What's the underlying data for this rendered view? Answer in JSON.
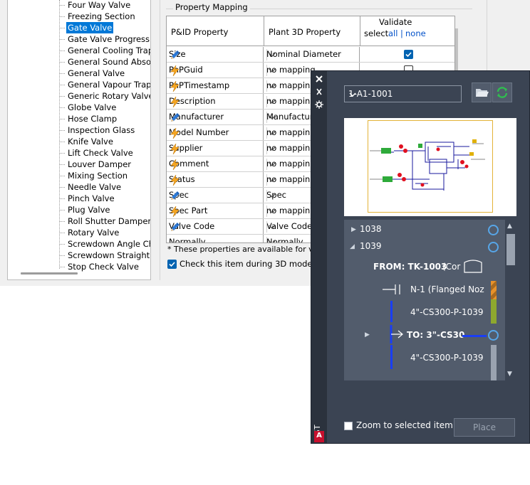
{
  "tree": {
    "items": [
      "Four Way Valve",
      "Freezing Section",
      "Gate Valve",
      "Gate Valve Progressi",
      "General Cooling Trap",
      "General Sound Abso",
      "General Valve",
      "General Vapour Trap",
      "Generic Rotary Valve",
      "Globe Valve",
      "Hose Clamp",
      "Inspection Glass",
      "Knife Valve",
      "Lift Check Valve",
      "Louver Damper",
      "Mixing Section",
      "Needle Valve",
      "Pinch Valve",
      "Plug Valve",
      "Roll Shutter Damper",
      "Rotary Valve",
      "Screwdown Angle Ch",
      "Screwdown Straight",
      "Stop Check Valve"
    ],
    "selected_index": 2
  },
  "mapping": {
    "group_title": "Property Mapping",
    "col_pid": "P&ID Property",
    "col_plant": "Plant 3D Property",
    "col_validate": "Validate",
    "select_label": "select",
    "select_all": "all",
    "select_sep": "|",
    "select_none": "none",
    "rows": [
      {
        "name": "Size",
        "icon": "pencil-icon",
        "map": "Nominal Diameter",
        "checked": true
      },
      {
        "name": "PnPGuid",
        "icon": "lightning-icon",
        "map": "no mapping",
        "checked": false
      },
      {
        "name": "PnPTimestamp",
        "icon": "lightning-icon",
        "map": "no mapping",
        "checked": false
      },
      {
        "name": "Description",
        "icon": "lightning-icon",
        "map": "no mapping",
        "checked": false
      },
      {
        "name": "Manufacturer",
        "icon": "pencil-icon",
        "map": "Manufacturer",
        "checked": false
      },
      {
        "name": "Model Number",
        "icon": "lightning-icon",
        "map": "no mapping",
        "checked": false
      },
      {
        "name": "Supplier",
        "icon": "lightning-icon",
        "map": "no mapping",
        "checked": false
      },
      {
        "name": "Comment",
        "icon": "lightning-icon",
        "map": "no mapping",
        "checked": false
      },
      {
        "name": "Status",
        "icon": "lightning-icon",
        "map": "no mapping",
        "checked": false
      },
      {
        "name": "Spec",
        "icon": "pencil-icon",
        "map": "Spec",
        "checked": false
      },
      {
        "name": "Spec Part",
        "icon": "lightning-icon",
        "map": "no mapping",
        "checked": false
      },
      {
        "name": "Valve Code",
        "icon": "pencil-icon",
        "map": "Valve Code",
        "checked": false
      },
      {
        "name": "Normally",
        "icon": "",
        "map": "Normally",
        "checked": false
      }
    ],
    "footnote": "* These properties are available for valida",
    "check_label": "Check this item during 3D model to Pa"
  },
  "palette": {
    "title": "P&ID LINE LIST",
    "drawing": "1-A1-1001",
    "tree": {
      "n1038": "1038",
      "n1039": "1039",
      "from_bold": "FROM: TK-1003",
      "from_rest": "(Cor",
      "nozzle": "N-1  (Flanged Noz",
      "line1": "4\"-CS300-P-1039",
      "to": "TO: 3\"-CS30",
      "line2": "4\"-CS300-P-1039"
    },
    "zoom_label": "Zoom to selected item",
    "place_label": "Place"
  }
}
